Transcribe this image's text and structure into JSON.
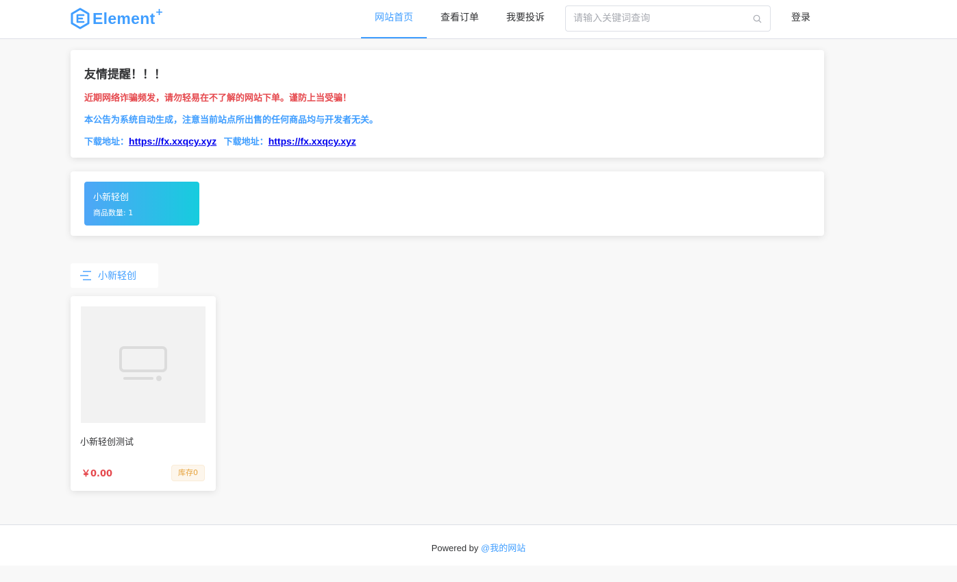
{
  "header": {
    "logo_text": "Element",
    "logo_plus": "+",
    "nav": [
      {
        "label": "网站首页",
        "active": true
      },
      {
        "label": "查看订单",
        "active": false
      },
      {
        "label": "我要投诉",
        "active": false
      }
    ],
    "search_placeholder": "请输入关键词查询",
    "login_label": "登录"
  },
  "notice": {
    "title": "友情提醒！！！",
    "line1": "近期网络诈骗频发，请勿轻易在不了解的网站下单。谨防上当受骗！",
    "line2": "本公告为系统自动生成，注意当前站点所出售的任何商品均与开发者无关。",
    "download_label_1": "下载地址：",
    "download_url_1": "https://fx.xxqcy.xyz",
    "download_label_2": "下载地址：",
    "download_url_2": "https://fx.xxqcy.xyz"
  },
  "categories": [
    {
      "name": "小新轻创",
      "count_text": "商品数量: 1"
    }
  ],
  "section": {
    "title": "小新轻创"
  },
  "products": [
    {
      "name": "小新轻创测试",
      "price": "￥0.00",
      "stock": "库存0"
    }
  ],
  "footer": {
    "powered_by": "Powered by ",
    "site_name": "@我的网站"
  },
  "colors": {
    "accent": "#409eff",
    "danger": "#e5484d",
    "warning": "#e6a23c"
  }
}
